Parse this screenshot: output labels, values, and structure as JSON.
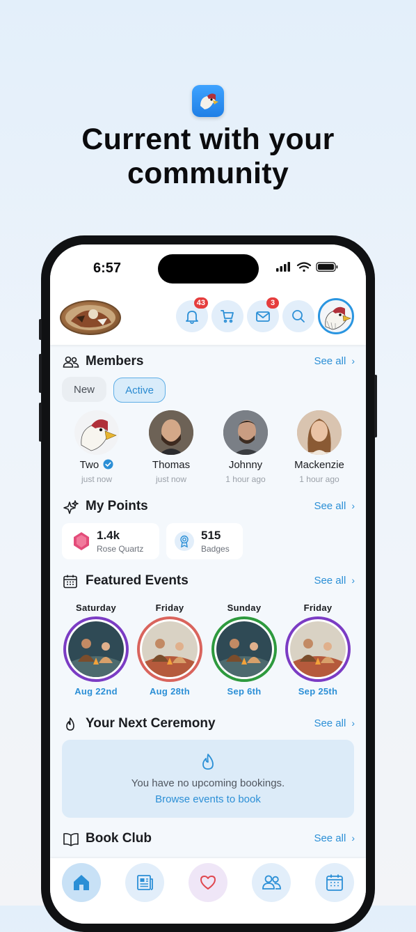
{
  "headline": "Current with your community",
  "status_bar": {
    "time": "6:57"
  },
  "topbar": {
    "notifications_badge": "43",
    "messages_badge": "3"
  },
  "members": {
    "title": "Members",
    "see_all": "See all",
    "tabs": {
      "new": "New",
      "active": "Active"
    },
    "list": [
      {
        "name": "Two",
        "time": "just now",
        "verified": true
      },
      {
        "name": "Thomas",
        "time": "just now"
      },
      {
        "name": "Johnny",
        "time": "1 hour ago"
      },
      {
        "name": "Mackenzie",
        "time": "1 hour ago"
      }
    ]
  },
  "points": {
    "title": "My Points",
    "see_all": "See all",
    "cards": [
      {
        "value": "1.4k",
        "label": "Rose Quartz"
      },
      {
        "value": "515",
        "label": "Badges"
      }
    ]
  },
  "events": {
    "title": "Featured Events",
    "see_all": "See all",
    "items": [
      {
        "day": "Saturday",
        "date": "Aug 22nd",
        "ring_color": "#7b3cc4"
      },
      {
        "day": "Friday",
        "date": "Aug 28th",
        "ring_color": "#d9645d"
      },
      {
        "day": "Sunday",
        "date": "Sep 6th",
        "ring_color": "#2e9a3e"
      },
      {
        "day": "Friday",
        "date": "Sep 25th",
        "ring_color": "#7b3cc4"
      }
    ]
  },
  "ceremony": {
    "title": "Your Next Ceremony",
    "see_all": "See all",
    "empty_message": "You have no upcoming bookings.",
    "browse_link": "Browse events to book"
  },
  "book_club": {
    "title": "Book Club",
    "see_all": "See all"
  },
  "colors": {
    "accent": "#2b8fd6",
    "badge": "#e53d3d"
  }
}
